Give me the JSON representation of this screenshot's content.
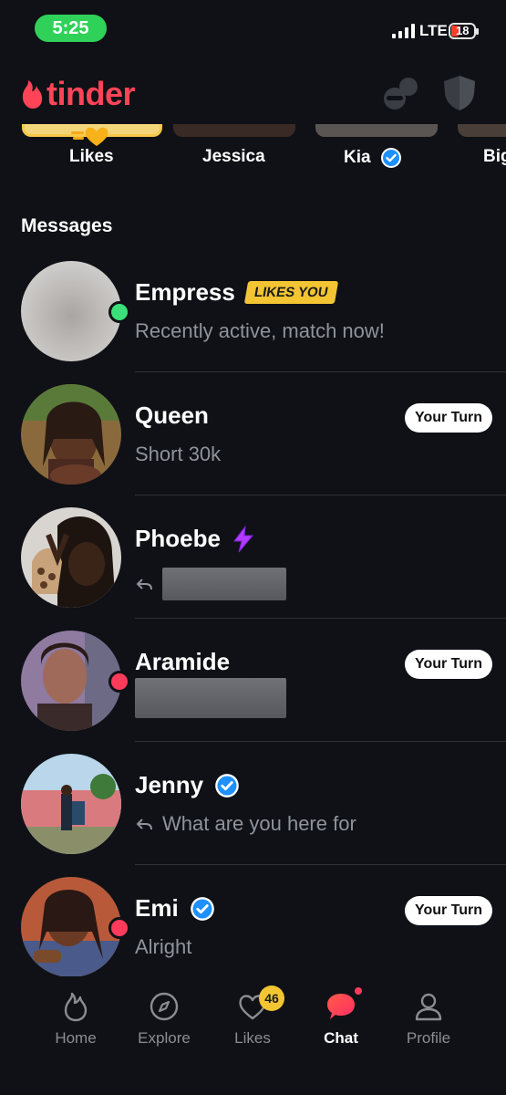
{
  "status_bar": {
    "time": "5:25",
    "network": "LTE",
    "battery_level": "18"
  },
  "header": {
    "brand": "tinder",
    "brand_color": "#ff4458"
  },
  "top_strip": {
    "items": [
      "Likes",
      "Jessica",
      "Kia",
      "Big"
    ]
  },
  "messages": {
    "title": "Messages",
    "items": [
      {
        "name": "Empress",
        "badge": "LIKES YOU",
        "preview": "Recently active, match now!",
        "online_status": "active"
      },
      {
        "name": "Queen",
        "preview": "Short 30k",
        "action": "Your Turn"
      },
      {
        "name": "Phoebe",
        "preview_redacted": true
      },
      {
        "name": "Aramide",
        "preview_redacted": true,
        "action": "Your Turn"
      },
      {
        "name": "Jenny",
        "verified": true,
        "preview": "What are you here for"
      },
      {
        "name": "Emi",
        "verified": true,
        "preview": "Alright",
        "action": "Your Turn"
      }
    ]
  },
  "tabbar": {
    "home": "Home",
    "explore": "Explore",
    "likes": "Likes",
    "likes_count": "46",
    "chat": "Chat",
    "profile": "Profile",
    "active_tab": "Chat"
  }
}
